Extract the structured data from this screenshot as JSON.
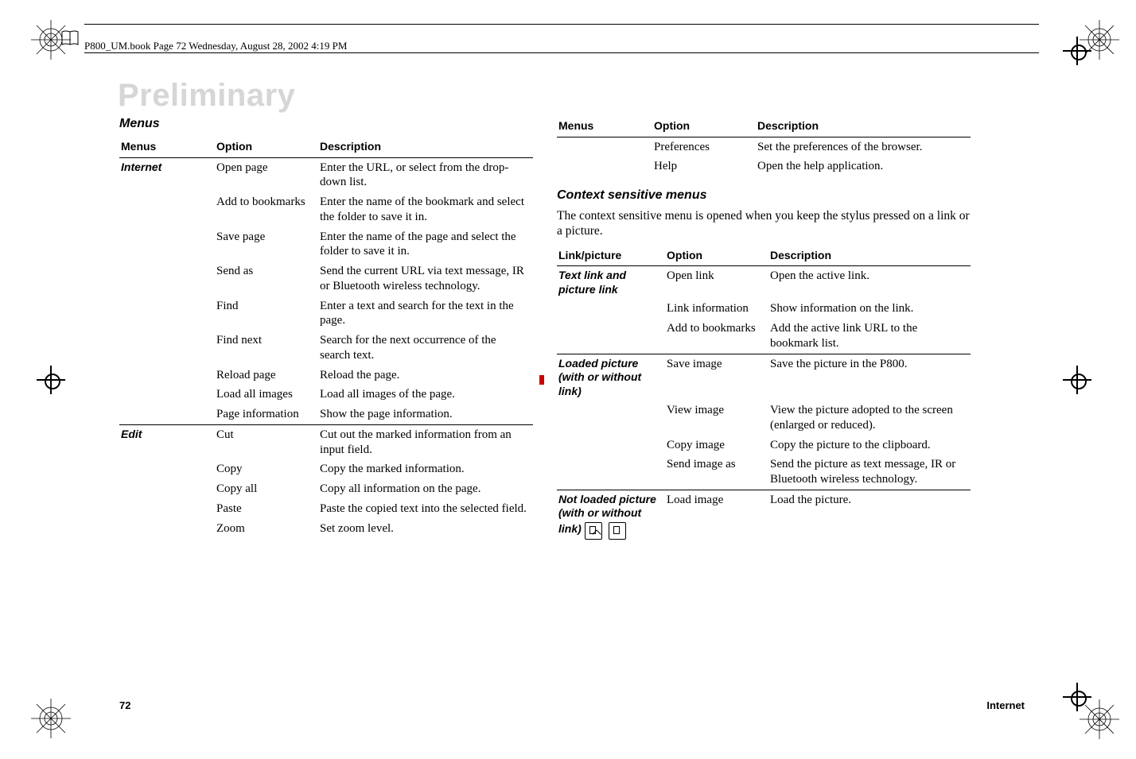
{
  "header": {
    "running": "P800_UM.book  Page 72  Wednesday, August 28, 2002  4:19 PM"
  },
  "watermark": "Preliminary",
  "left": {
    "section_title": "Menus",
    "th_menus": "Menus",
    "th_option": "Option",
    "th_desc": "Description",
    "internet_label": "Internet",
    "edit_label": "Edit",
    "rows": {
      "open_page": {
        "opt": "Open page",
        "desc": "Enter the URL, or select from the drop-down list."
      },
      "add_bookmarks": {
        "opt": "Add to bookmarks",
        "desc": "Enter the name of the bookmark and select the folder to save it in."
      },
      "save_page": {
        "opt": "Save page",
        "desc": "Enter the name of the page and select the folder to save it in."
      },
      "send_as": {
        "opt": "Send as",
        "desc": "Send the current URL via text message, IR or Bluetooth wireless technology."
      },
      "find": {
        "opt": "Find",
        "desc": "Enter a text and search for the text in the page."
      },
      "find_next": {
        "opt": "Find next",
        "desc": "Search for the next occurrence of the search text."
      },
      "reload": {
        "opt": "Reload page",
        "desc": "Reload the page."
      },
      "load_all": {
        "opt": "Load all images",
        "desc": "Load all images of the page."
      },
      "page_info": {
        "opt": "Page information",
        "desc": "Show the page information."
      },
      "cut": {
        "opt": "Cut",
        "desc": "Cut out the marked information from an input field."
      },
      "copy": {
        "opt": "Copy",
        "desc": "Copy the marked information."
      },
      "copy_all": {
        "opt": "Copy all",
        "desc": "Copy all information on the page."
      },
      "paste": {
        "opt": "Paste",
        "desc": "Paste the copied text into the selected field."
      },
      "zoom": {
        "opt": "Zoom",
        "desc": "Set zoom level."
      }
    }
  },
  "right_top": {
    "th_menus": "Menus",
    "th_option": "Option",
    "th_desc": "Description",
    "rows": {
      "prefs": {
        "opt": "Preferences",
        "desc": "Set the preferences of the browser."
      },
      "help": {
        "opt": "Help",
        "desc": "Open the help application."
      }
    }
  },
  "context": {
    "heading": "Context sensitive menus",
    "intro": "The context sensitive menu is opened when you keep the stylus pressed on a link or a picture.",
    "th_link": "Link/picture",
    "th_option": "Option",
    "th_desc": "Description",
    "textlink_label": "Text link and picture link",
    "loaded_label": "Loaded picture (with or without link)",
    "notloaded_label": "Not loaded picture (with or without link)",
    "rows": {
      "open_link": {
        "opt": "Open link",
        "desc": "Open the active link."
      },
      "link_info": {
        "opt": "Link information",
        "desc": "Show information on the link."
      },
      "add_bm": {
        "opt": "Add to bookmarks",
        "desc": "Add the active link URL to the bookmark list."
      },
      "save_img": {
        "opt": "Save image",
        "desc": "Save the picture in the P800."
      },
      "view_img": {
        "opt": "View image",
        "desc": "View the picture adopted to the screen (enlarged or reduced)."
      },
      "copy_img": {
        "opt": "Copy image",
        "desc": "Copy the picture to the clipboard."
      },
      "send_img": {
        "opt": "Send image as",
        "desc": "Send the picture as text message, IR or Bluetooth wireless technology."
      },
      "load_img": {
        "opt": "Load image",
        "desc": "Load the picture."
      }
    }
  },
  "footer": {
    "page": "72",
    "section": "Internet"
  }
}
